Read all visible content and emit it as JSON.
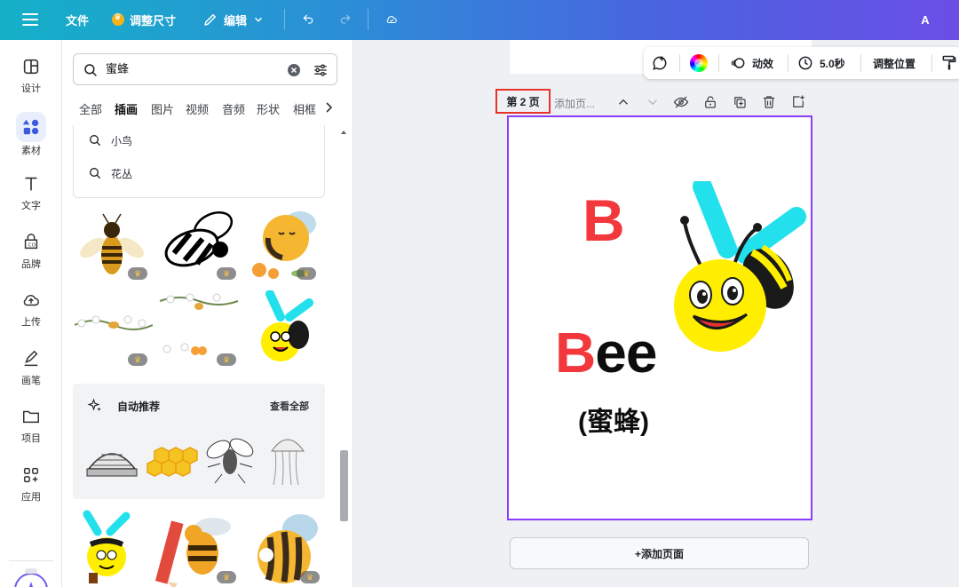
{
  "topbar": {
    "file": "文件",
    "resize": "调整尺寸",
    "edit": "编辑",
    "avatar": "A"
  },
  "rail": {
    "items": [
      {
        "label": "设计",
        "icon": "layout-icon"
      },
      {
        "label": "素材",
        "icon": "elements-icon"
      },
      {
        "label": "文字",
        "icon": "text-icon"
      },
      {
        "label": "品牌",
        "icon": "brand-icon"
      },
      {
        "label": "上传",
        "icon": "upload-icon"
      },
      {
        "label": "画笔",
        "icon": "draw-icon"
      },
      {
        "label": "项目",
        "icon": "folder-icon"
      },
      {
        "label": "应用",
        "icon": "apps-icon"
      }
    ]
  },
  "panel": {
    "search_value": "蜜蜂",
    "tabs": [
      "全部",
      "插画",
      "图片",
      "视频",
      "音频",
      "形状",
      "相框"
    ],
    "active_tab": "插画",
    "suggestions": [
      "小鸟",
      "花丛"
    ],
    "reco_title": "自动推荐",
    "reco_all": "查看全部"
  },
  "toolbar": {
    "animate": "动效",
    "duration": "5.0秒",
    "position": "调整位置"
  },
  "page": {
    "label": "第 2 页",
    "title_placeholder": "添加页...",
    "letter": "B",
    "word_red": "B",
    "word_rest": "ee",
    "word_cn": "(蜜蜂)"
  },
  "add_page": "+添加页面",
  "colors": {
    "accent": "#8b3dff",
    "highlight": "#e5322b",
    "letter_red": "#f2383c"
  }
}
